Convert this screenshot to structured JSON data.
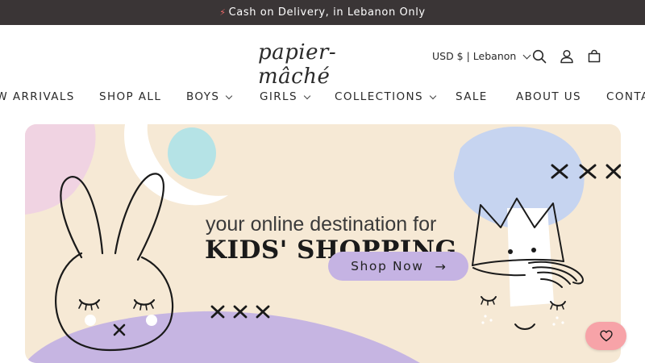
{
  "announcement": {
    "icon": "lightning-icon",
    "text": "Cash on Delivery, in Lebanon Only"
  },
  "header": {
    "logo_text": "papier-mâché",
    "currency_label": "USD $ | Lebanon",
    "icons": [
      "search-icon",
      "account-icon",
      "cart-icon"
    ]
  },
  "nav": {
    "items": [
      {
        "label": "NEW ARRIVALS"
      },
      {
        "label": "SHOP ALL"
      },
      {
        "label": "BOYS"
      },
      {
        "label": "GIRLS"
      },
      {
        "label": "COLLECTIONS"
      },
      {
        "label": "SALE"
      },
      {
        "label": "ABOUT US"
      },
      {
        "label": "CONTACT"
      }
    ]
  },
  "hero": {
    "tagline": "your online destination for",
    "headline": "KIDS' SHOPPING",
    "cta_label": "Shop Now",
    "cta_arrow": "→"
  },
  "colors": {
    "announcement_bg": "#3a3536",
    "hero_bg": "#f6e9d5",
    "cta_bg": "#c5b3e3",
    "wishlist_bg": "#f7a3a8",
    "pink_blob": "#f0d3e2",
    "aqua_blob": "#b5e3e6",
    "blue_blob": "#c6d4f0",
    "purple_hill": "#c6b5e2"
  },
  "wishlist": {
    "icon": "heart-icon"
  }
}
